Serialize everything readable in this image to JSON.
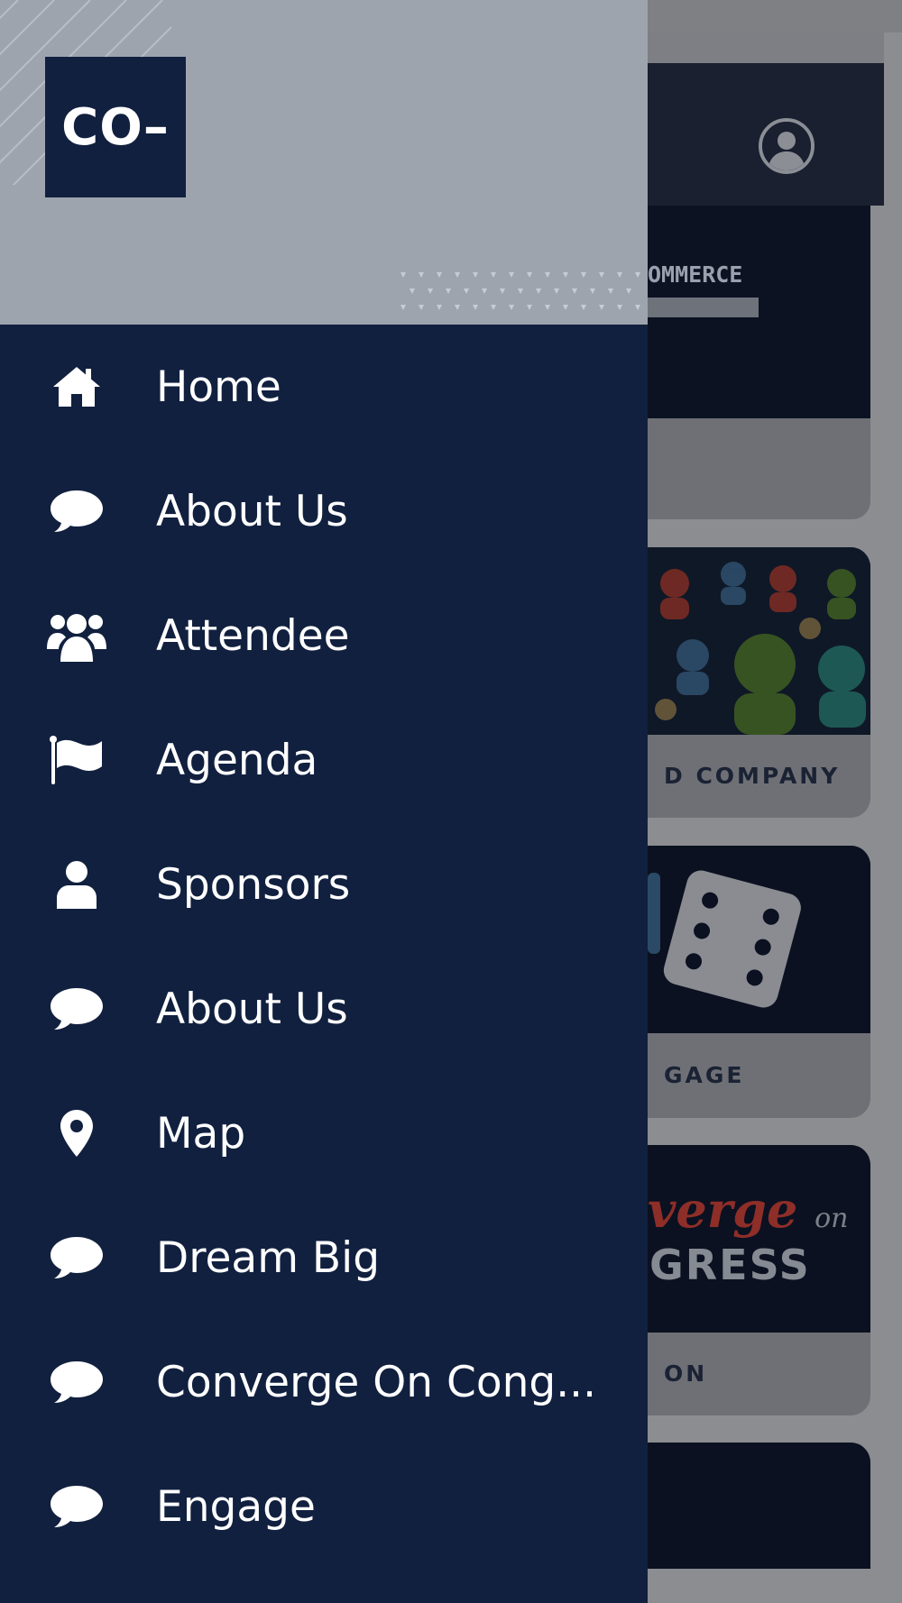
{
  "app": {
    "logo_text": "CO–"
  },
  "menu": {
    "items": [
      {
        "label": "Home",
        "icon": "home-icon"
      },
      {
        "label": "About Us",
        "icon": "chat-bubble-icon"
      },
      {
        "label": "Attendee",
        "icon": "users-icon"
      },
      {
        "label": "Agenda",
        "icon": "flag-icon"
      },
      {
        "label": "Sponsors",
        "icon": "user-icon"
      },
      {
        "label": "About Us",
        "icon": "chat-bubble-icon"
      },
      {
        "label": "Map",
        "icon": "map-pin-icon"
      },
      {
        "label": "Dream Big",
        "icon": "chat-bubble-icon"
      },
      {
        "label": "Converge On Cong...",
        "icon": "chat-bubble-icon"
      },
      {
        "label": "Engage",
        "icon": "chat-bubble-icon"
      }
    ]
  },
  "background": {
    "cards": [
      {
        "image_text": "OMMERCE",
        "caption": ""
      },
      {
        "image_text": "",
        "caption": "D COMPANY"
      },
      {
        "image_text": "",
        "caption": "GAGE"
      },
      {
        "image_text_1": "verge",
        "image_text_1_small": "on",
        "image_text_2": "GRESS",
        "caption": "ON CONGRESS"
      },
      {
        "caption": ""
      }
    ]
  },
  "colors": {
    "drawer_bg": "#11203f",
    "drawer_header_bg": "#9ea4ae",
    "text": "#ffffff",
    "overlay": "#8b8d91"
  }
}
